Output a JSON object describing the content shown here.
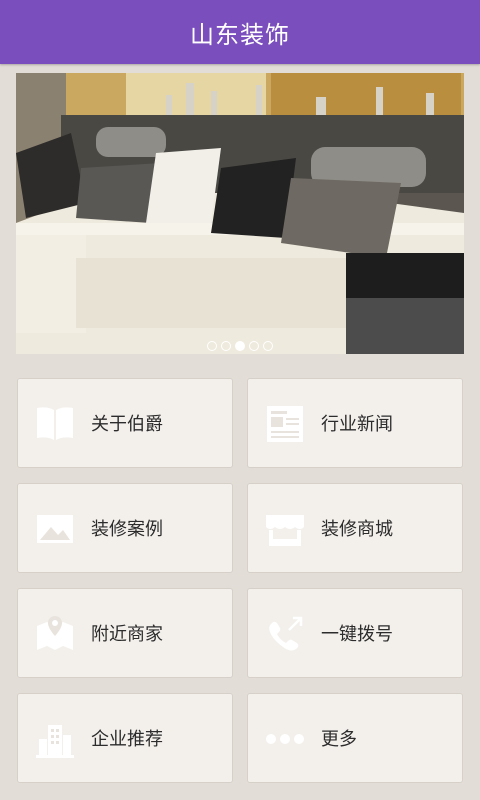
{
  "header": {
    "title": "山东装饰"
  },
  "banner": {
    "slides": 5,
    "active_index": 2
  },
  "menu": [
    {
      "label": "关于伯爵",
      "icon": "book-icon"
    },
    {
      "label": "行业新闻",
      "icon": "news-icon"
    },
    {
      "label": "装修案例",
      "icon": "image-icon"
    },
    {
      "label": "装修商城",
      "icon": "store-icon"
    },
    {
      "label": "附近商家",
      "icon": "map-icon"
    },
    {
      "label": "一键拨号",
      "icon": "phone-icon"
    },
    {
      "label": "企业推荐",
      "icon": "building-icon"
    },
    {
      "label": "更多",
      "icon": "more-icon"
    }
  ],
  "colors": {
    "header_bg": "#7a4fbd",
    "icon_color": "#ffffff",
    "page_bg": "#e3ddd7",
    "tile_bg": "#f3f0ec"
  }
}
